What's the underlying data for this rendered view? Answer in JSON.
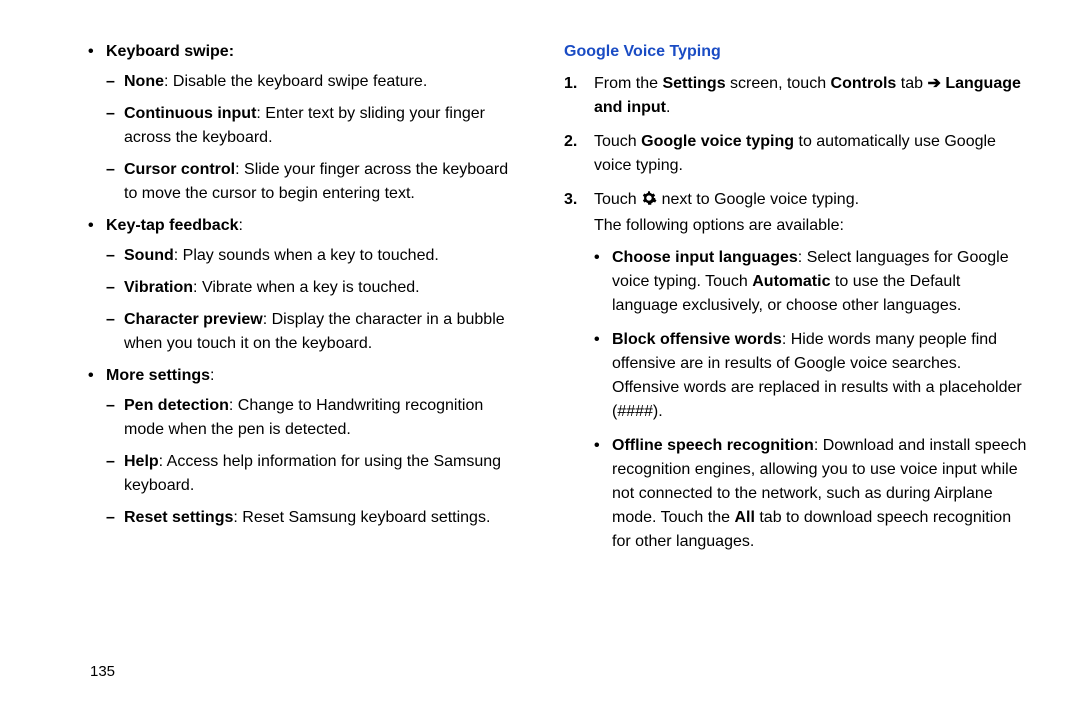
{
  "left": {
    "items": [
      {
        "title": "Keyboard swipe",
        "colonInside": true,
        "subs": [
          {
            "label": "None",
            "text": ": Disable the keyboard swipe feature."
          },
          {
            "label": "Continuous input",
            "text": ": Enter text by sliding your finger across the keyboard."
          },
          {
            "label": "Cursor control",
            "text": ": Slide your finger across the keyboard to move the cursor to begin entering text."
          }
        ]
      },
      {
        "title": "Key-tap feedback",
        "subs": [
          {
            "label": "Sound",
            "text": ": Play sounds when a key to touched."
          },
          {
            "label": "Vibration",
            "text": ": Vibrate when a key is touched."
          },
          {
            "label": "Character preview",
            "text": ": Display the character in a bubble when you touch it on the keyboard."
          }
        ]
      },
      {
        "title": "More settings",
        "subs": [
          {
            "label": "Pen detection",
            "text": ": Change to Handwriting recognition mode when the pen is detected."
          },
          {
            "label": "Help",
            "text": ": Access help information for using the Samsung keyboard."
          },
          {
            "label": "Reset settings",
            "text": ": Reset Samsung keyboard settings."
          }
        ]
      }
    ]
  },
  "right": {
    "heading": "Google Voice Typing",
    "step1": {
      "pre": "From the ",
      "bold1": "Settings",
      "mid1": " screen, touch ",
      "bold2": "Controls",
      "mid2": " tab ",
      "arrow": "➔",
      "bold3": "Language and input",
      "post": "."
    },
    "step2": {
      "pre": "Touch ",
      "bold1": "Google voice typing",
      "post": " to automatically use Google voice typing."
    },
    "step3": {
      "pre": "Touch ",
      "mid": " next to Google voice typing.",
      "line2": "The following options are available:"
    },
    "sub": [
      {
        "label": "Choose input languages",
        "t1": ": Select languages for Google voice typing. Touch ",
        "bold2": "Automatic",
        "t2": " to use the Default language exclusively, or choose other languages."
      },
      {
        "label": "Block offensive words",
        "t1": ": Hide words many people find offensive are in results of Google voice searches. Offensive words are replaced in results with a placeholder (####)."
      },
      {
        "label": "Offline speech recognition",
        "t1": ": Download and install speech recognition engines, allowing you to use voice input while not connected to the network, such as during Airplane mode. Touch the ",
        "bold2": "All",
        "t2": " tab to download speech recognition for other languages."
      }
    ]
  },
  "pageNumber": "135"
}
